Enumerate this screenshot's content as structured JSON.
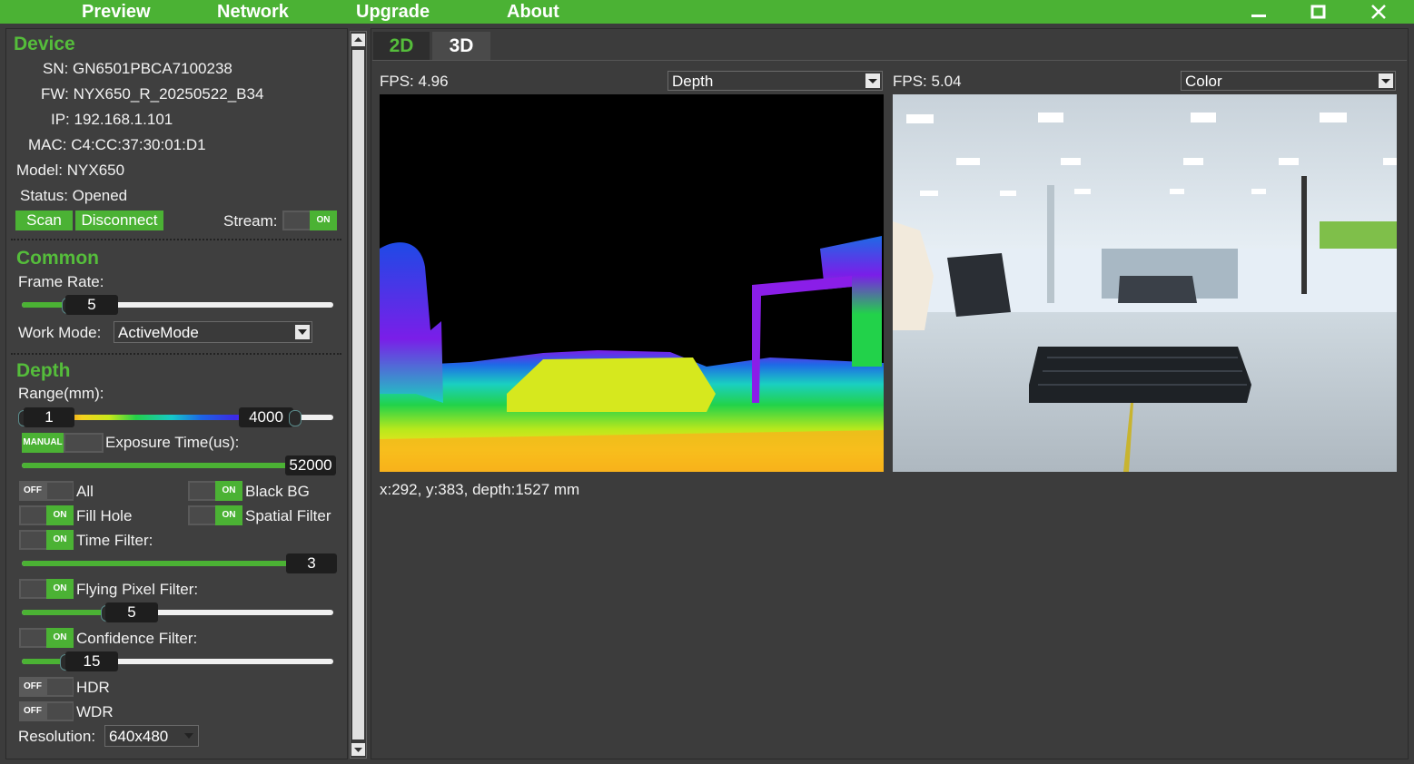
{
  "menu": {
    "preview": "Preview",
    "network": "Network",
    "upgrade": "Upgrade",
    "about": "About"
  },
  "window": {
    "minimize": "—",
    "maximize": "☐",
    "close": "✕"
  },
  "device": {
    "title": "Device",
    "sn": "SN: GN6501PBCA7100238",
    "fw": "FW: NYX650_R_20250522_B34",
    "ip": "IP: 192.168.1.101",
    "mac": "MAC: C4:CC:37:30:01:D1",
    "model": "Model: NYX650",
    "status": "Status: Opened",
    "scan_label": "Scan",
    "disconnect_label": "Disconnect",
    "stream_label": "Stream:",
    "stream_switch": "ON"
  },
  "common": {
    "title": "Common",
    "frame_rate_label": "Frame Rate:",
    "frame_rate_value": "5",
    "frame_rate_fraction": 0.17,
    "work_mode_label": "Work Mode:",
    "work_mode_value": "ActiveMode"
  },
  "depth": {
    "title": "Depth",
    "range_label": "Range(mm):",
    "range_min": "1",
    "range_max": "4000",
    "exposure_switch": "MANUAL",
    "exposure_label": "Exposure Time(us):",
    "exposure_value": "52000",
    "all_label": "All",
    "all_switch": "OFF",
    "black_bg_label": "Black BG",
    "black_bg_switch": "ON",
    "fill_hole_label": "Fill Hole",
    "fill_hole_switch": "ON",
    "spatial_label": "Spatial Filter",
    "spatial_switch": "ON",
    "time_filter_label": "Time Filter:",
    "time_filter_switch": "ON",
    "time_filter_value": "3",
    "flying_label": "Flying Pixel Filter:",
    "flying_switch": "ON",
    "flying_value": "5",
    "confidence_label": "Confidence Filter:",
    "confidence_switch": "ON",
    "confidence_value": "15",
    "hdr_label": "HDR",
    "hdr_switch": "OFF",
    "wdr_label": "WDR",
    "wdr_switch": "OFF",
    "resolution_label": "Resolution:",
    "resolution_value": "640x480"
  },
  "view": {
    "tab_2d": "2D",
    "tab_3d": "3D",
    "left_fps": "FPS: 4.96",
    "left_mode": "Depth",
    "right_fps": "FPS: 5.04",
    "right_mode": "Color",
    "readout": "x:292, y:383, depth:1527 mm"
  },
  "colors": {
    "accent": "#4bb234",
    "accent_text": "#55bd3b",
    "background": "#3c3c3c"
  }
}
